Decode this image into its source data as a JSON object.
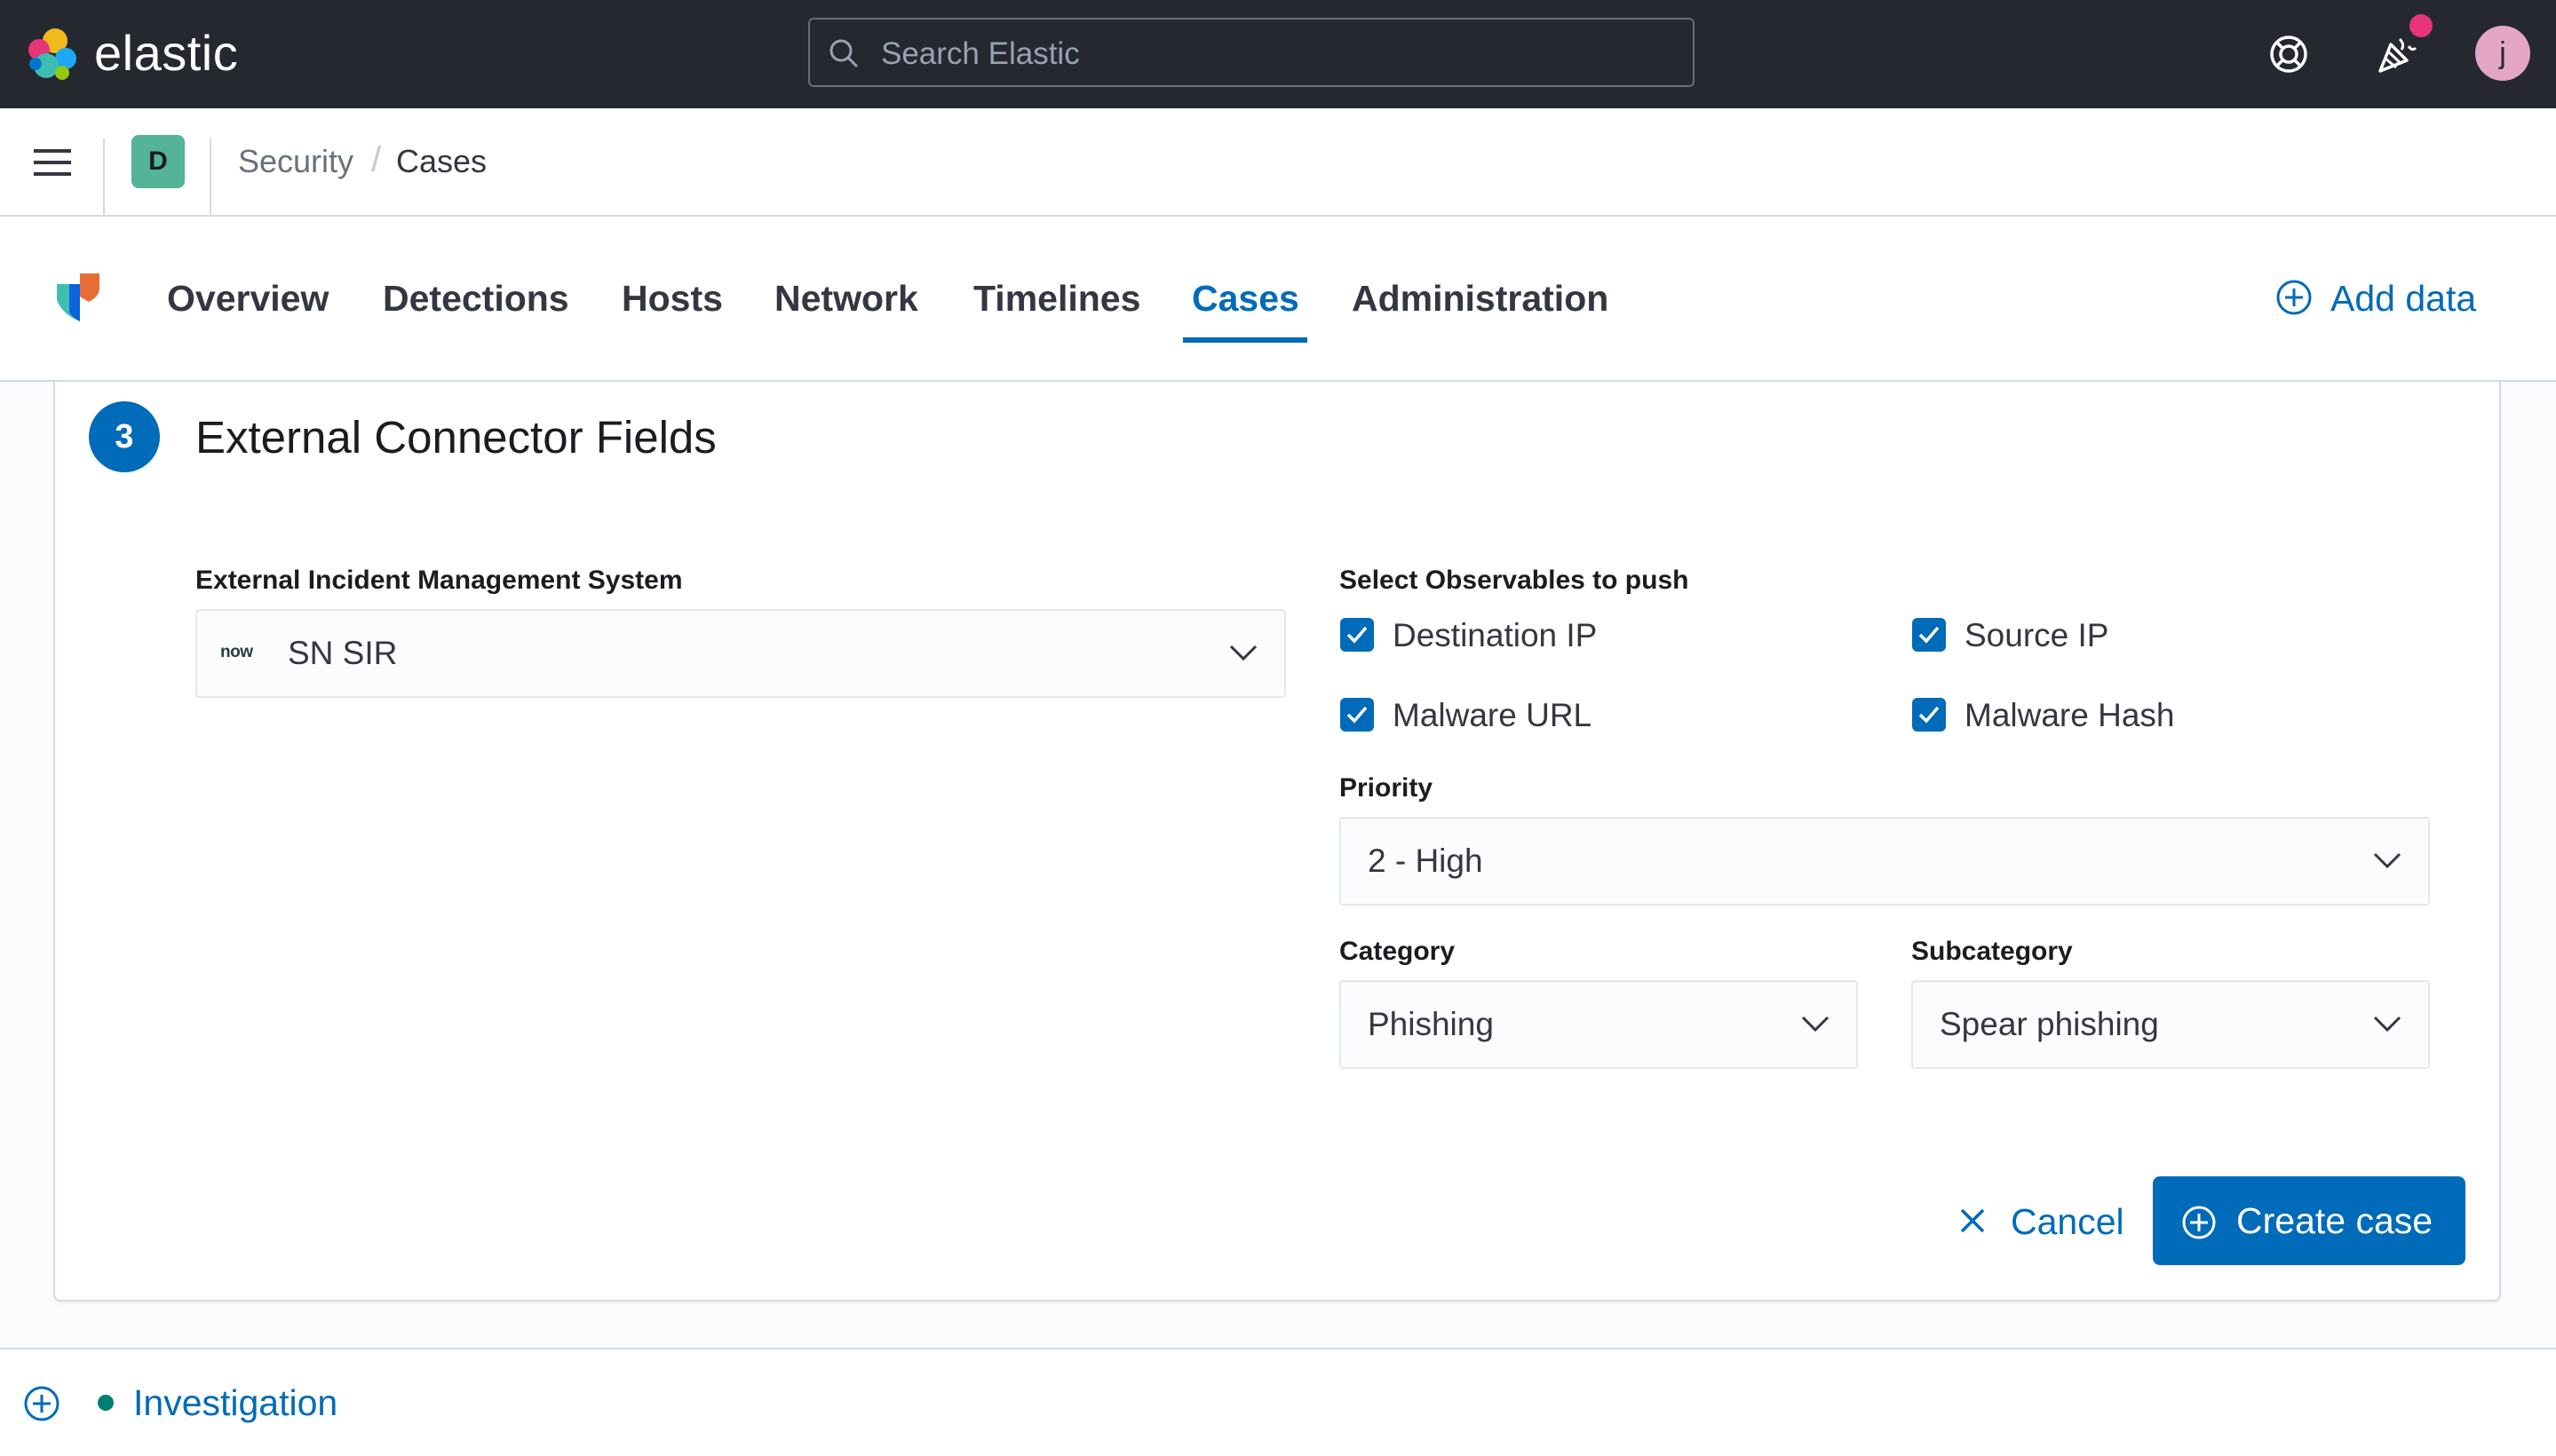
{
  "header": {
    "logo_text": "elastic",
    "search_placeholder": "Search Elastic",
    "avatar_initial": "j",
    "help_icon": "help-lifebuoy-icon",
    "news_icon": "newsfeed-cheer-icon"
  },
  "breadcrumb": {
    "space_initial": "D",
    "items": [
      "Security",
      "Cases"
    ],
    "separator": "/"
  },
  "nav": {
    "tabs": [
      {
        "label": "Overview",
        "active": false
      },
      {
        "label": "Detections",
        "active": false
      },
      {
        "label": "Hosts",
        "active": false
      },
      {
        "label": "Network",
        "active": false
      },
      {
        "label": "Timelines",
        "active": false
      },
      {
        "label": "Cases",
        "active": true
      },
      {
        "label": "Administration",
        "active": false
      }
    ],
    "add_data_label": "Add data"
  },
  "step": {
    "number": "3",
    "title": "External Connector Fields"
  },
  "form": {
    "system_label": "External Incident Management System",
    "system_logo_text": "now",
    "system_value": "SN SIR",
    "observables_label": "Select Observables to push",
    "observables": [
      {
        "label": "Destination IP",
        "checked": true
      },
      {
        "label": "Source IP",
        "checked": true
      },
      {
        "label": "Malware URL",
        "checked": true
      },
      {
        "label": "Malware Hash",
        "checked": true
      }
    ],
    "priority_label": "Priority",
    "priority_value": "2 - High",
    "category_label": "Category",
    "category_value": "Phishing",
    "subcategory_label": "Subcategory",
    "subcategory_value": "Spear phishing"
  },
  "actions": {
    "cancel_label": "Cancel",
    "create_label": "Create case"
  },
  "bottom": {
    "timeline_label": "Investigation"
  },
  "colors": {
    "primary": "#006bb8",
    "header_bg": "#25282f",
    "space_badge": "#54b399",
    "notification_dot": "#e7357a",
    "avatar_bg": "#e4a6c7",
    "timeline_dot": "#017d73"
  }
}
